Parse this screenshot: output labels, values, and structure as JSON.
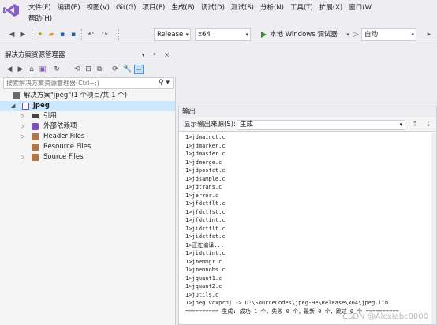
{
  "menu": {
    "row1": [
      "文件(F)",
      "编辑(E)",
      "视图(V)",
      "Git(G)",
      "项目(P)",
      "生成(B)",
      "调试(D)",
      "测试(S)",
      "分析(N)",
      "工具(T)",
      "扩展(X)",
      "窗口(W"
    ],
    "row2": [
      "帮助(H)"
    ]
  },
  "toolbar": {
    "config": "Release",
    "platform": "x64",
    "run_label": "本地 Windows 调试器",
    "run_mode": "自动"
  },
  "solution_explorer": {
    "title": "解决方案资源管理器",
    "title_buttons": "▾ ᵖ ×",
    "search_placeholder": "搜索解决方案资源管理器(Ctrl+;)",
    "solution_label": "解决方案\"jpeg\"(1 个项目/共 1 个)",
    "project": "jpeg",
    "nodes": [
      "引用",
      "外部依赖项",
      "Header Files",
      "Resource Files",
      "Source Files"
    ]
  },
  "output": {
    "title": "输出",
    "source_label": "显示输出来源(S):",
    "source_value": "生成",
    "lines": [
      "1>jdmainct.c",
      "1>jdmarker.c",
      "1>jdmaster.c",
      "1>jdmerge.c",
      "1>jdpostct.c",
      "1>jdsample.c",
      "1>jdtrans.c",
      "1>jerror.c",
      "1>jfdctflt.c",
      "1>jfdctfst.c",
      "1>jfdctint.c",
      "1>jidctflt.c",
      "1>jidctfst.c",
      "1>正在编译...",
      "1>jidctint.c",
      "1>jmemmgr.c",
      "1>jmemnobs.c",
      "1>jquant1.c",
      "1>jquant2.c",
      "1>jutils.c",
      "1>jpeg.vcxproj -> D:\\SourceCodes\\jpeg-9e\\Release\\x64\\jpeg.lib",
      "========== 生成: 成功 1 个，失败 0 个，最新 0 个，跳过 0 个 =========="
    ],
    "watermark": "CSDN @Alcxiabc0000"
  }
}
